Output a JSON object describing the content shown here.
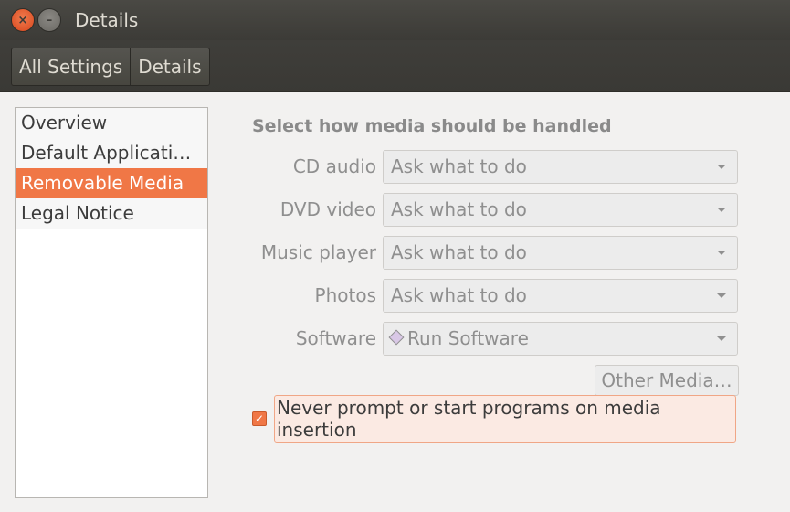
{
  "window": {
    "title": "Details",
    "close_icon": "×",
    "minimize_icon": "–"
  },
  "toolbar": {
    "breadcrumbs": [
      "All Settings",
      "Details"
    ]
  },
  "sidebar": {
    "items": [
      {
        "label": "Overview"
      },
      {
        "label": "Default Applicati…"
      },
      {
        "label": "Removable Media",
        "selected": true
      },
      {
        "label": "Legal Notice"
      }
    ]
  },
  "main": {
    "section_title": "Select how media should be handled",
    "rows": [
      {
        "label": "CD audio",
        "value": "Ask what to do"
      },
      {
        "label": "DVD video",
        "value": "Ask what to do"
      },
      {
        "label": "Music player",
        "value": "Ask what to do"
      },
      {
        "label": "Photos",
        "value": "Ask what to do"
      },
      {
        "label": "Software",
        "value": "Run Software",
        "icon": "software-icon"
      }
    ],
    "other_media_label": "Other Media…",
    "never_prompt": {
      "label": "Never prompt or start programs on media insertion",
      "checked": true,
      "check_glyph": "✓"
    }
  },
  "colors": {
    "accent": "#f07746",
    "titlebar": "#3c3b37"
  }
}
